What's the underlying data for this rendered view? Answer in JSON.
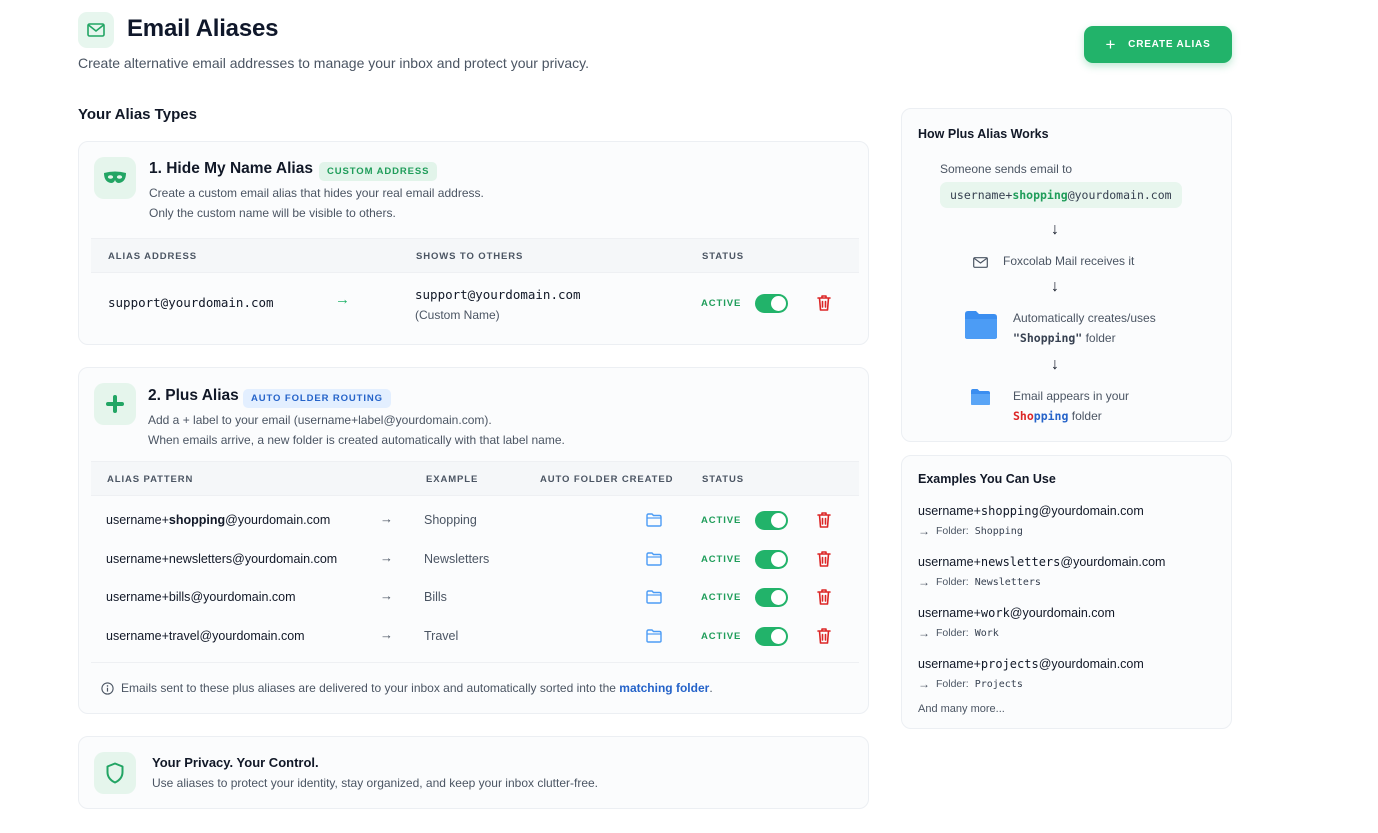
{
  "header": {
    "title": "Email Aliases",
    "subtitle": "Create alternative email addresses to manage your inbox and protect your privacy.",
    "create_button": "CREATE ALIAS",
    "icon": "mail-icon"
  },
  "section_title": "Your Alias Types",
  "hide_my_name": {
    "title": "1. Hide My Name Alias",
    "badge": "CUSTOM ADDRESS",
    "desc_line1": "Create a custom email alias that hides your real email address.",
    "desc_line2": "Only the custom name will be visible to others.",
    "columns": [
      "ALIAS ADDRESS",
      "SHOWS TO OTHERS",
      "STATUS"
    ],
    "row": {
      "alias": "support@yourdomain.com",
      "shows": "support@yourdomain.com",
      "shows_note": "(Custom Name)",
      "status": "ACTIVE"
    }
  },
  "plus_alias": {
    "title": "2. Plus Alias",
    "badge": "AUTO FOLDER ROUTING",
    "desc_line1": "Add a + label to your email (username+label@yourdomain.com).",
    "desc_line2": "When emails arrive, a new folder is created automatically with that label name.",
    "columns": [
      "ALIAS PATTERN",
      "EXAMPLE",
      "AUTO FOLDER CREATED",
      "STATUS"
    ],
    "rows": [
      {
        "prefix": "username+",
        "label": "shopping",
        "suffix": "@yourdomain.com",
        "example": "Shopping",
        "status": "ACTIVE"
      },
      {
        "prefix": "username+",
        "label": "newsletters",
        "suffix": "@yourdomain.com",
        "example": "Newsletters",
        "status": "ACTIVE"
      },
      {
        "prefix": "username+",
        "label": "bills",
        "suffix": "@yourdomain.com",
        "example": "Bills",
        "status": "ACTIVE"
      },
      {
        "prefix": "username+",
        "label": "travel",
        "suffix": "@yourdomain.com",
        "example": "Travel",
        "status": "ACTIVE"
      }
    ],
    "note_text": "Emails sent to these plus aliases are delivered to your inbox and automatically sorted into the",
    "note_link": "matching folder",
    "note_end": "."
  },
  "privacy": {
    "title": "Your Privacy. Your Control.",
    "desc": "Use aliases to protect your identity, stay organized, and keep your inbox clutter-free."
  },
  "how_it_works": {
    "title": "How Plus Alias Works",
    "step1": "Someone sends email to",
    "step1_prefix": "username+",
    "step1_label": "shopping",
    "step1_suffix": "@yourdomain.com",
    "step2": "Foxcolab Mail receives it",
    "step3_line1": "Automatically creates/uses",
    "step3_folder": "\"Shopping\"",
    "step3_suffix": " folder",
    "step4_line1": "Email appears in your",
    "step4_red": "Sho",
    "step4_blue": "pping",
    "step4_suffix": " folder"
  },
  "examples": {
    "title": "Examples You Can Use",
    "folder_label": "Folder:",
    "items": [
      {
        "prefix": "username+",
        "label": "shopping",
        "suffix": "@yourdomain.com",
        "folder": "Shopping"
      },
      {
        "prefix": "username+",
        "label": "newsletters",
        "suffix": "@yourdomain.com",
        "folder": "Newsletters"
      },
      {
        "prefix": "username+",
        "label": "work",
        "suffix": "@yourdomain.com",
        "folder": "Work"
      },
      {
        "prefix": "username+",
        "label": "projects",
        "suffix": "@yourdomain.com",
        "folder": "Projects"
      }
    ],
    "more": "And many more..."
  },
  "colors": {
    "accent_green": "#22b36a",
    "status_green": "#1f9d5a",
    "link_blue": "#2563c9",
    "delete_red": "#dc2626"
  }
}
